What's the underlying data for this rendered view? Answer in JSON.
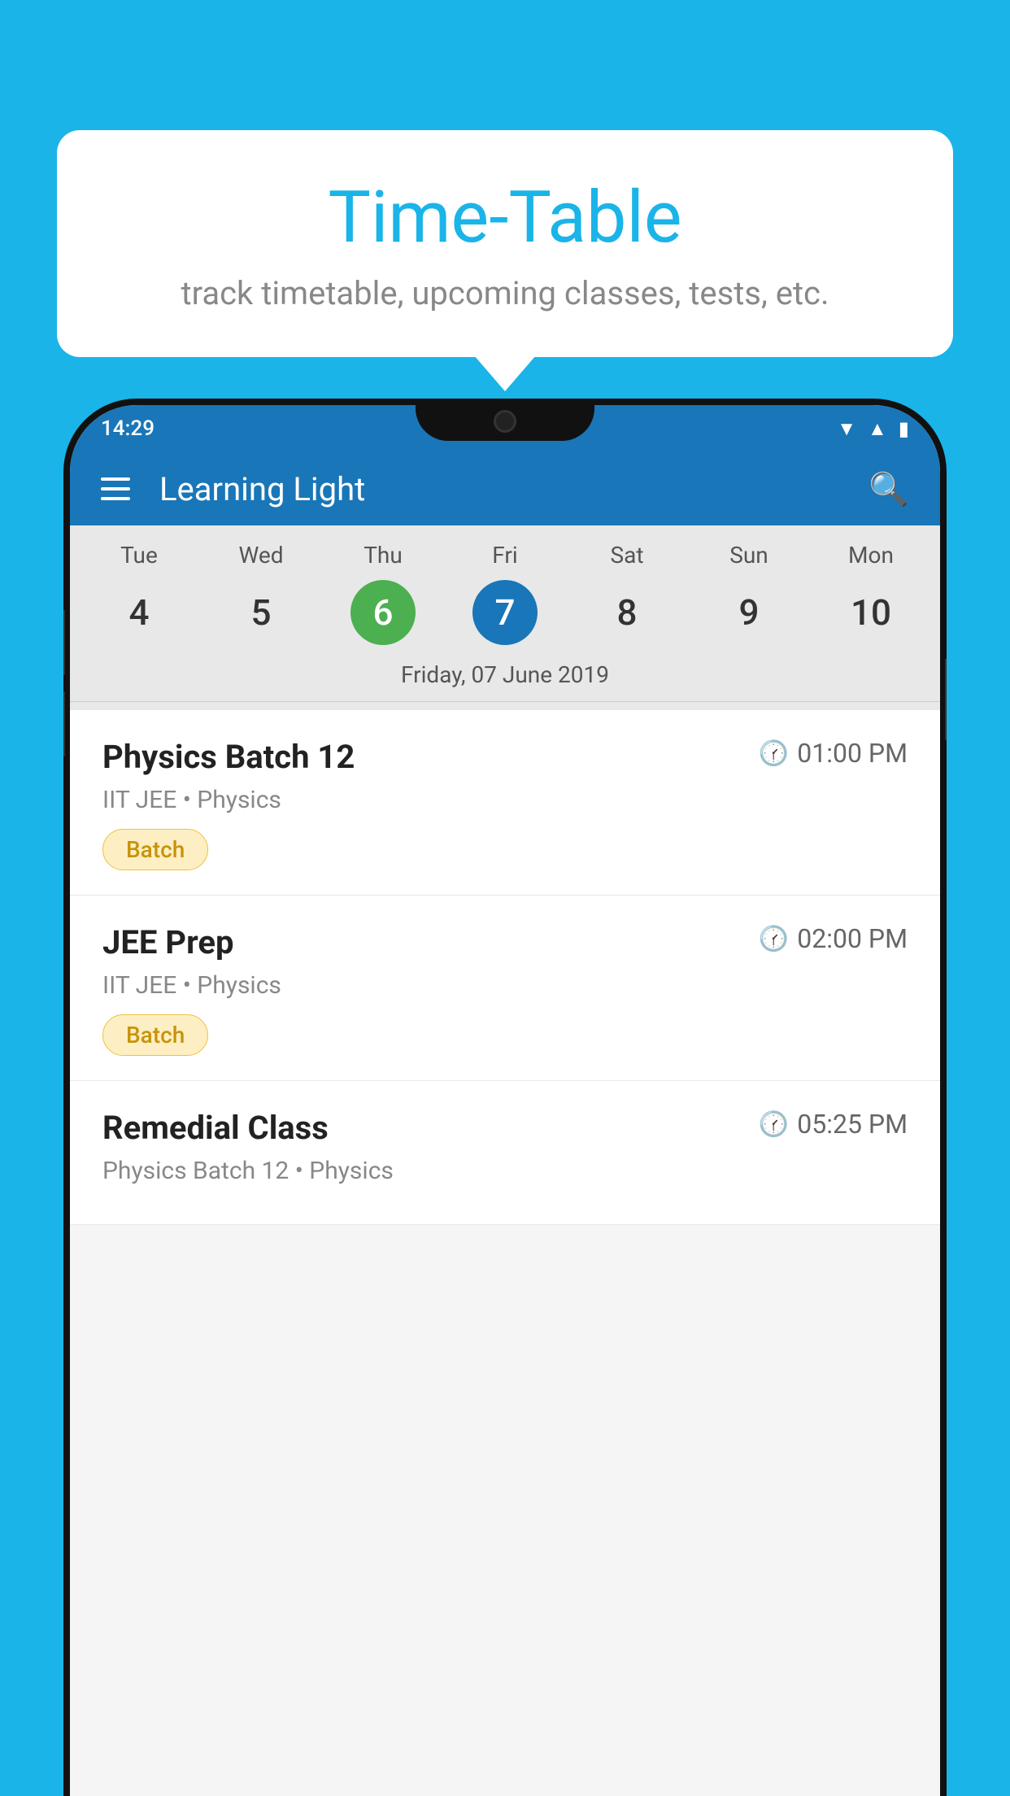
{
  "background": {
    "color": "#1ab4e8"
  },
  "tooltip": {
    "title": "Time-Table",
    "subtitle": "track timetable, upcoming classes, tests, etc."
  },
  "phone": {
    "status_bar": {
      "time": "14:29"
    },
    "app_bar": {
      "title": "Learning Light"
    },
    "calendar": {
      "days": [
        {
          "name": "Tue",
          "num": "4",
          "state": "normal"
        },
        {
          "name": "Wed",
          "num": "5",
          "state": "normal"
        },
        {
          "name": "Thu",
          "num": "6",
          "state": "today"
        },
        {
          "name": "Fri",
          "num": "7",
          "state": "selected"
        },
        {
          "name": "Sat",
          "num": "8",
          "state": "normal"
        },
        {
          "name": "Sun",
          "num": "9",
          "state": "normal"
        },
        {
          "name": "Mon",
          "num": "10",
          "state": "normal"
        }
      ],
      "selected_date_label": "Friday, 07 June 2019"
    },
    "schedule": [
      {
        "title": "Physics Batch 12",
        "time": "01:00 PM",
        "subtitle": "IIT JEE • Physics",
        "badge": "Batch"
      },
      {
        "title": "JEE Prep",
        "time": "02:00 PM",
        "subtitle": "IIT JEE • Physics",
        "badge": "Batch"
      },
      {
        "title": "Remedial Class",
        "time": "05:25 PM",
        "subtitle": "Physics Batch 12 • Physics",
        "badge": null
      }
    ]
  }
}
